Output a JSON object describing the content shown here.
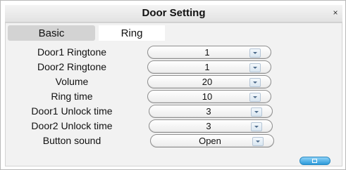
{
  "window": {
    "title": "Door Setting",
    "close_glyph": "×"
  },
  "tabs": [
    {
      "label": "Basic"
    },
    {
      "label": "Ring"
    }
  ],
  "settings": [
    {
      "label": "Door1 Ringtone",
      "value": "1"
    },
    {
      "label": "Door2 Ringtone",
      "value": "1"
    },
    {
      "label": "Volume",
      "value": "20"
    },
    {
      "label": "Ring time",
      "value": "10"
    },
    {
      "label": "Door1 Unlock time",
      "value": "3"
    },
    {
      "label": "Door2 Unlock time",
      "value": "3"
    },
    {
      "label": "Button sound",
      "value": "Open"
    }
  ],
  "icons": {
    "close": "close-icon",
    "dropdown": "chevron-down-icon",
    "save": "save-icon"
  },
  "colors": {
    "title_bar": "#e6e6e6",
    "panel_bg": "#f2f2f2",
    "active_tab": "#d3d3d3",
    "save_button": "#2b9ad9"
  }
}
